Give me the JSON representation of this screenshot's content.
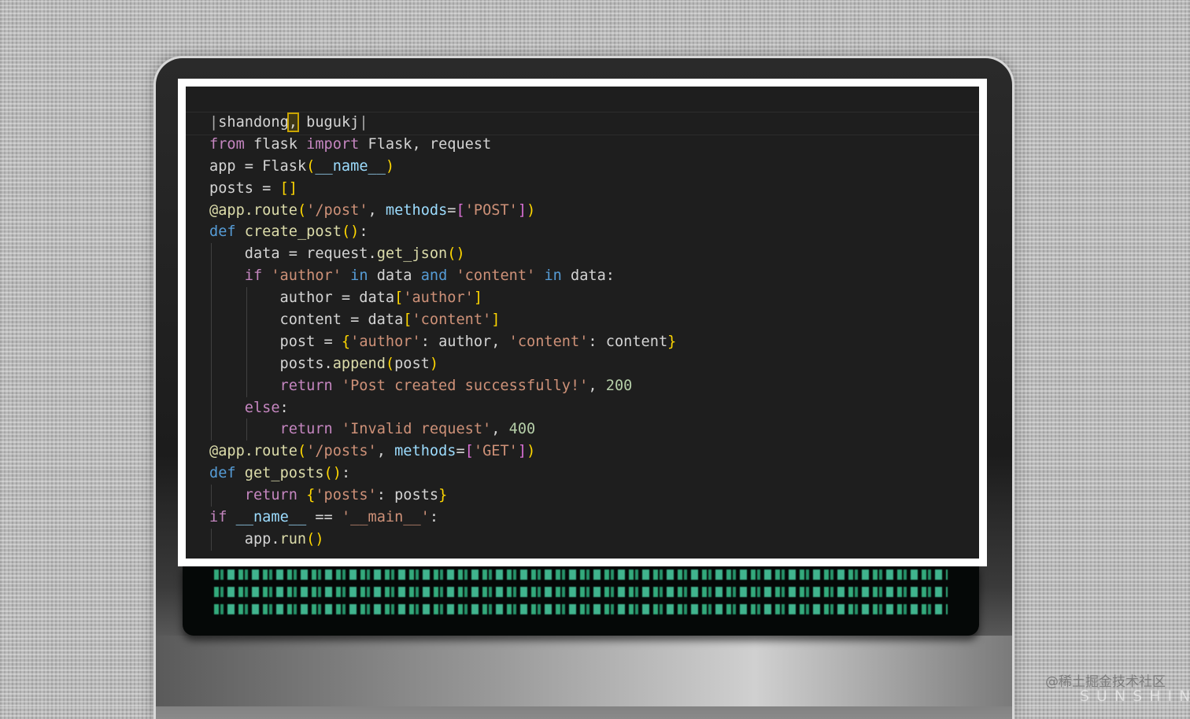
{
  "editor": {
    "lines": [
      {
        "indent": 0,
        "tokens": [
          [
            "|",
            "cur"
          ],
          [
            "shandong",
            "plain"
          ],
          [
            ",",
            "sel"
          ],
          [
            " bugukj",
            "plain"
          ],
          [
            "|",
            "cur"
          ]
        ]
      },
      {
        "indent": 0,
        "tokens": [
          [
            "from",
            "kw"
          ],
          [
            " flask ",
            "plain"
          ],
          [
            "import",
            "kw"
          ],
          [
            " Flask, request",
            "plain"
          ]
        ]
      },
      {
        "indent": 0,
        "tokens": [
          [
            "app = Flask",
            "plain"
          ],
          [
            "(",
            "b1"
          ],
          [
            "__name__",
            "var"
          ],
          [
            ")",
            "b1"
          ]
        ]
      },
      {
        "indent": 0,
        "tokens": [
          [
            "posts = ",
            "plain"
          ],
          [
            "[]",
            "b1"
          ]
        ]
      },
      {
        "indent": 0,
        "tokens": [
          [
            "@app.route",
            "fn"
          ],
          [
            "(",
            "b1"
          ],
          [
            "'/post'",
            "str"
          ],
          [
            ", ",
            "plain"
          ],
          [
            "methods",
            "var"
          ],
          [
            "=",
            "plain"
          ],
          [
            "[",
            "b2"
          ],
          [
            "'POST'",
            "str"
          ],
          [
            "]",
            "b2"
          ],
          [
            ")",
            "b1"
          ]
        ]
      },
      {
        "indent": 0,
        "tokens": [
          [
            "def",
            "def"
          ],
          [
            " ",
            "plain"
          ],
          [
            "create_post",
            "fn"
          ],
          [
            "()",
            "b1"
          ],
          [
            ":",
            "plain"
          ]
        ]
      },
      {
        "indent": 1,
        "tokens": [
          [
            "data = request.",
            "plain"
          ],
          [
            "get_json",
            "fn"
          ],
          [
            "()",
            "b1"
          ]
        ]
      },
      {
        "indent": 1,
        "tokens": [
          [
            "if",
            "kw"
          ],
          [
            " ",
            "plain"
          ],
          [
            "'author'",
            "str"
          ],
          [
            " ",
            "plain"
          ],
          [
            "in",
            "def"
          ],
          [
            " data ",
            "plain"
          ],
          [
            "and",
            "def"
          ],
          [
            " ",
            "plain"
          ],
          [
            "'content'",
            "str"
          ],
          [
            " ",
            "plain"
          ],
          [
            "in",
            "def"
          ],
          [
            " data:",
            "plain"
          ]
        ]
      },
      {
        "indent": 2,
        "tokens": [
          [
            "author = data",
            "plain"
          ],
          [
            "[",
            "b1"
          ],
          [
            "'author'",
            "str"
          ],
          [
            "]",
            "b1"
          ]
        ]
      },
      {
        "indent": 2,
        "tokens": [
          [
            "content = data",
            "plain"
          ],
          [
            "[",
            "b1"
          ],
          [
            "'content'",
            "str"
          ],
          [
            "]",
            "b1"
          ]
        ]
      },
      {
        "indent": 2,
        "tokens": [
          [
            "post = ",
            "plain"
          ],
          [
            "{",
            "b1"
          ],
          [
            "'author'",
            "str"
          ],
          [
            ": author, ",
            "plain"
          ],
          [
            "'content'",
            "str"
          ],
          [
            ": content",
            "plain"
          ],
          [
            "}",
            "b1"
          ]
        ]
      },
      {
        "indent": 2,
        "tokens": [
          [
            "posts.",
            "plain"
          ],
          [
            "append",
            "fn"
          ],
          [
            "(",
            "b1"
          ],
          [
            "post",
            "plain"
          ],
          [
            ")",
            "b1"
          ]
        ]
      },
      {
        "indent": 2,
        "tokens": [
          [
            "return",
            "kw"
          ],
          [
            " ",
            "plain"
          ],
          [
            "'Post created successfully!'",
            "str"
          ],
          [
            ", ",
            "plain"
          ],
          [
            "200",
            "num"
          ]
        ]
      },
      {
        "indent": 1,
        "tokens": [
          [
            "else",
            "kw"
          ],
          [
            ":",
            "plain"
          ]
        ]
      },
      {
        "indent": 2,
        "tokens": [
          [
            "return",
            "kw"
          ],
          [
            " ",
            "plain"
          ],
          [
            "'Invalid request'",
            "str"
          ],
          [
            ", ",
            "plain"
          ],
          [
            "400",
            "num"
          ]
        ]
      },
      {
        "indent": 0,
        "tokens": [
          [
            "@app.route",
            "fn"
          ],
          [
            "(",
            "b1"
          ],
          [
            "'/posts'",
            "str"
          ],
          [
            ", ",
            "plain"
          ],
          [
            "methods",
            "var"
          ],
          [
            "=",
            "plain"
          ],
          [
            "[",
            "b2"
          ],
          [
            "'GET'",
            "str"
          ],
          [
            "]",
            "b2"
          ],
          [
            ")",
            "b1"
          ]
        ]
      },
      {
        "indent": 0,
        "tokens": [
          [
            "def",
            "def"
          ],
          [
            " ",
            "plain"
          ],
          [
            "get_posts",
            "fn"
          ],
          [
            "()",
            "b1"
          ],
          [
            ":",
            "plain"
          ]
        ]
      },
      {
        "indent": 1,
        "tokens": [
          [
            "return",
            "kw"
          ],
          [
            " ",
            "plain"
          ],
          [
            "{",
            "b1"
          ],
          [
            "'posts'",
            "str"
          ],
          [
            ": posts",
            "plain"
          ],
          [
            "}",
            "b1"
          ]
        ]
      },
      {
        "indent": 0,
        "tokens": [
          [
            "if",
            "kw"
          ],
          [
            " ",
            "plain"
          ],
          [
            "__name__",
            "var"
          ],
          [
            " == ",
            "plain"
          ],
          [
            "'__main__'",
            "str"
          ],
          [
            ":",
            "plain"
          ]
        ]
      },
      {
        "indent": 1,
        "tokens": [
          [
            "app.",
            "plain"
          ],
          [
            "run",
            "fn"
          ],
          [
            "()",
            "b1"
          ]
        ]
      }
    ]
  },
  "watermark": {
    "line1": "@稀土掘金技术社区",
    "line2": "SUNSHINE"
  }
}
